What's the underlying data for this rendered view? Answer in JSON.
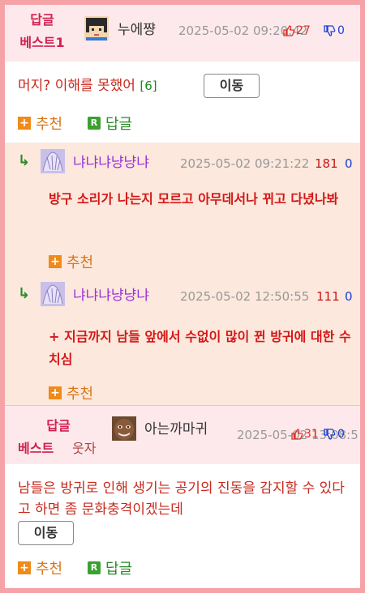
{
  "post1": {
    "tag_line1": "답글",
    "tag_line2": "베스트1",
    "nickname": "누에쨩",
    "date": "2025-05-02 09:20:42",
    "likes": "27",
    "dislikes": "0",
    "body": "머지? 이해를 못했어",
    "reply_count": "[6]",
    "move_label": "이동",
    "recommend_label": "추천",
    "reply_label": "답글"
  },
  "reply1": {
    "nickname": "냐냐냐냥냥냐",
    "date": "2025-05-02 09:21:22",
    "likes": "181",
    "dislikes": "0",
    "body": "방구 소리가 나는지 모르고 아무데서나 뀌고 다녔나봐",
    "recommend_label": "추천"
  },
  "reply2": {
    "nickname": "냐냐냐냥냥냐",
    "date": "2025-05-02 12:50:55",
    "likes": "111",
    "dislikes": "0",
    "body": "+ 지금까지 남들 앞에서 수없이 많이 뀐 방귀에 대한 수치심",
    "recommend_label": "추천"
  },
  "post2": {
    "tag_line1": "답글",
    "tag_line2a": "베스트",
    "tag_line2b": "웃자",
    "nickname": "아는까마귀",
    "date": "2025-05-02 13:08:5",
    "likes": "31",
    "dislikes": "0",
    "body": "남들은 방귀로 인해 생기는 공기의 진동을 감지할 수 있다고 하면 좀 문화충격이겠는데",
    "move_label": "이동",
    "recommend_label": "추천",
    "reply_label": "답글"
  },
  "colors": {
    "accent": "#d02050",
    "text_red": "#c8281e",
    "reply_bg": "#fce8dc",
    "header_bg": "#fde9ec",
    "frame": "#f6a3a8"
  },
  "icons": [
    "thumb-up-icon",
    "thumb-down-icon",
    "reply-arrow-icon",
    "plus-icon",
    "reply-r-icon"
  ]
}
